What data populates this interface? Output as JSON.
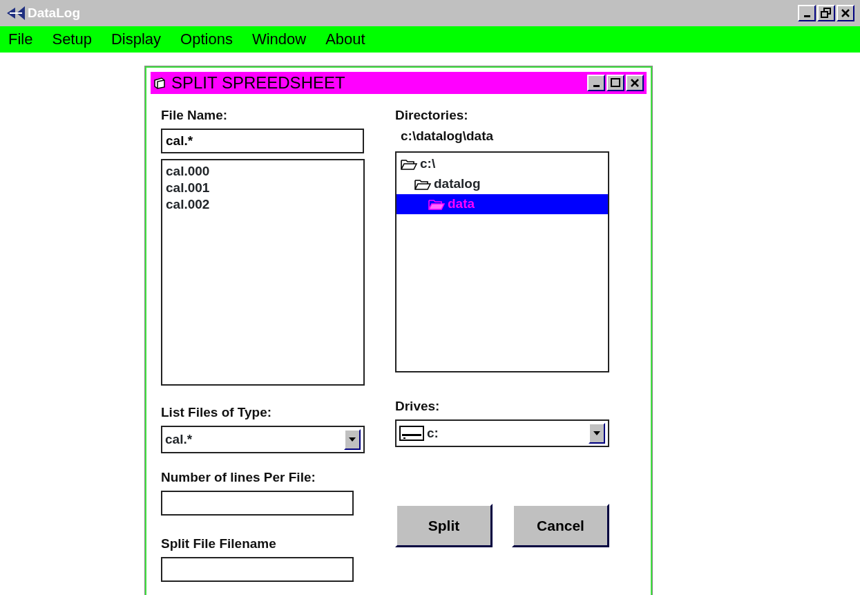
{
  "app": {
    "title": "DataLog"
  },
  "menu": [
    {
      "label": "File"
    },
    {
      "label": "Setup"
    },
    {
      "label": "Display"
    },
    {
      "label": "Options"
    },
    {
      "label": "Window"
    },
    {
      "label": "About"
    }
  ],
  "dialog": {
    "title": "SPLIT SPREEDSHEET",
    "file_name": {
      "label": "File Name:",
      "value": "cal.*"
    },
    "files": [
      {
        "name": "cal.000",
        "selected": false
      },
      {
        "name": "cal.001",
        "selected": false
      },
      {
        "name": "cal.002",
        "selected": false
      }
    ],
    "directories": {
      "label": "Directories:",
      "path": "c:\\datalog\\data",
      "tree": [
        {
          "name": "c:\\",
          "selected": false,
          "children": [
            {
              "name": "datalog",
              "selected": false,
              "children": [
                {
                  "name": "data",
                  "selected": true
                }
              ]
            }
          ]
        }
      ]
    },
    "file_type": {
      "label": "List Files of Type:",
      "value": "cal.*"
    },
    "drives": {
      "label": "Drives:",
      "value": "c:"
    },
    "lines_per_file": {
      "label": "Number of lines Per File:"
    },
    "split_filename": {
      "label": "Split File Filename"
    },
    "buttons": [
      {
        "label": "Split"
      },
      {
        "label": "Cancel"
      }
    ]
  }
}
